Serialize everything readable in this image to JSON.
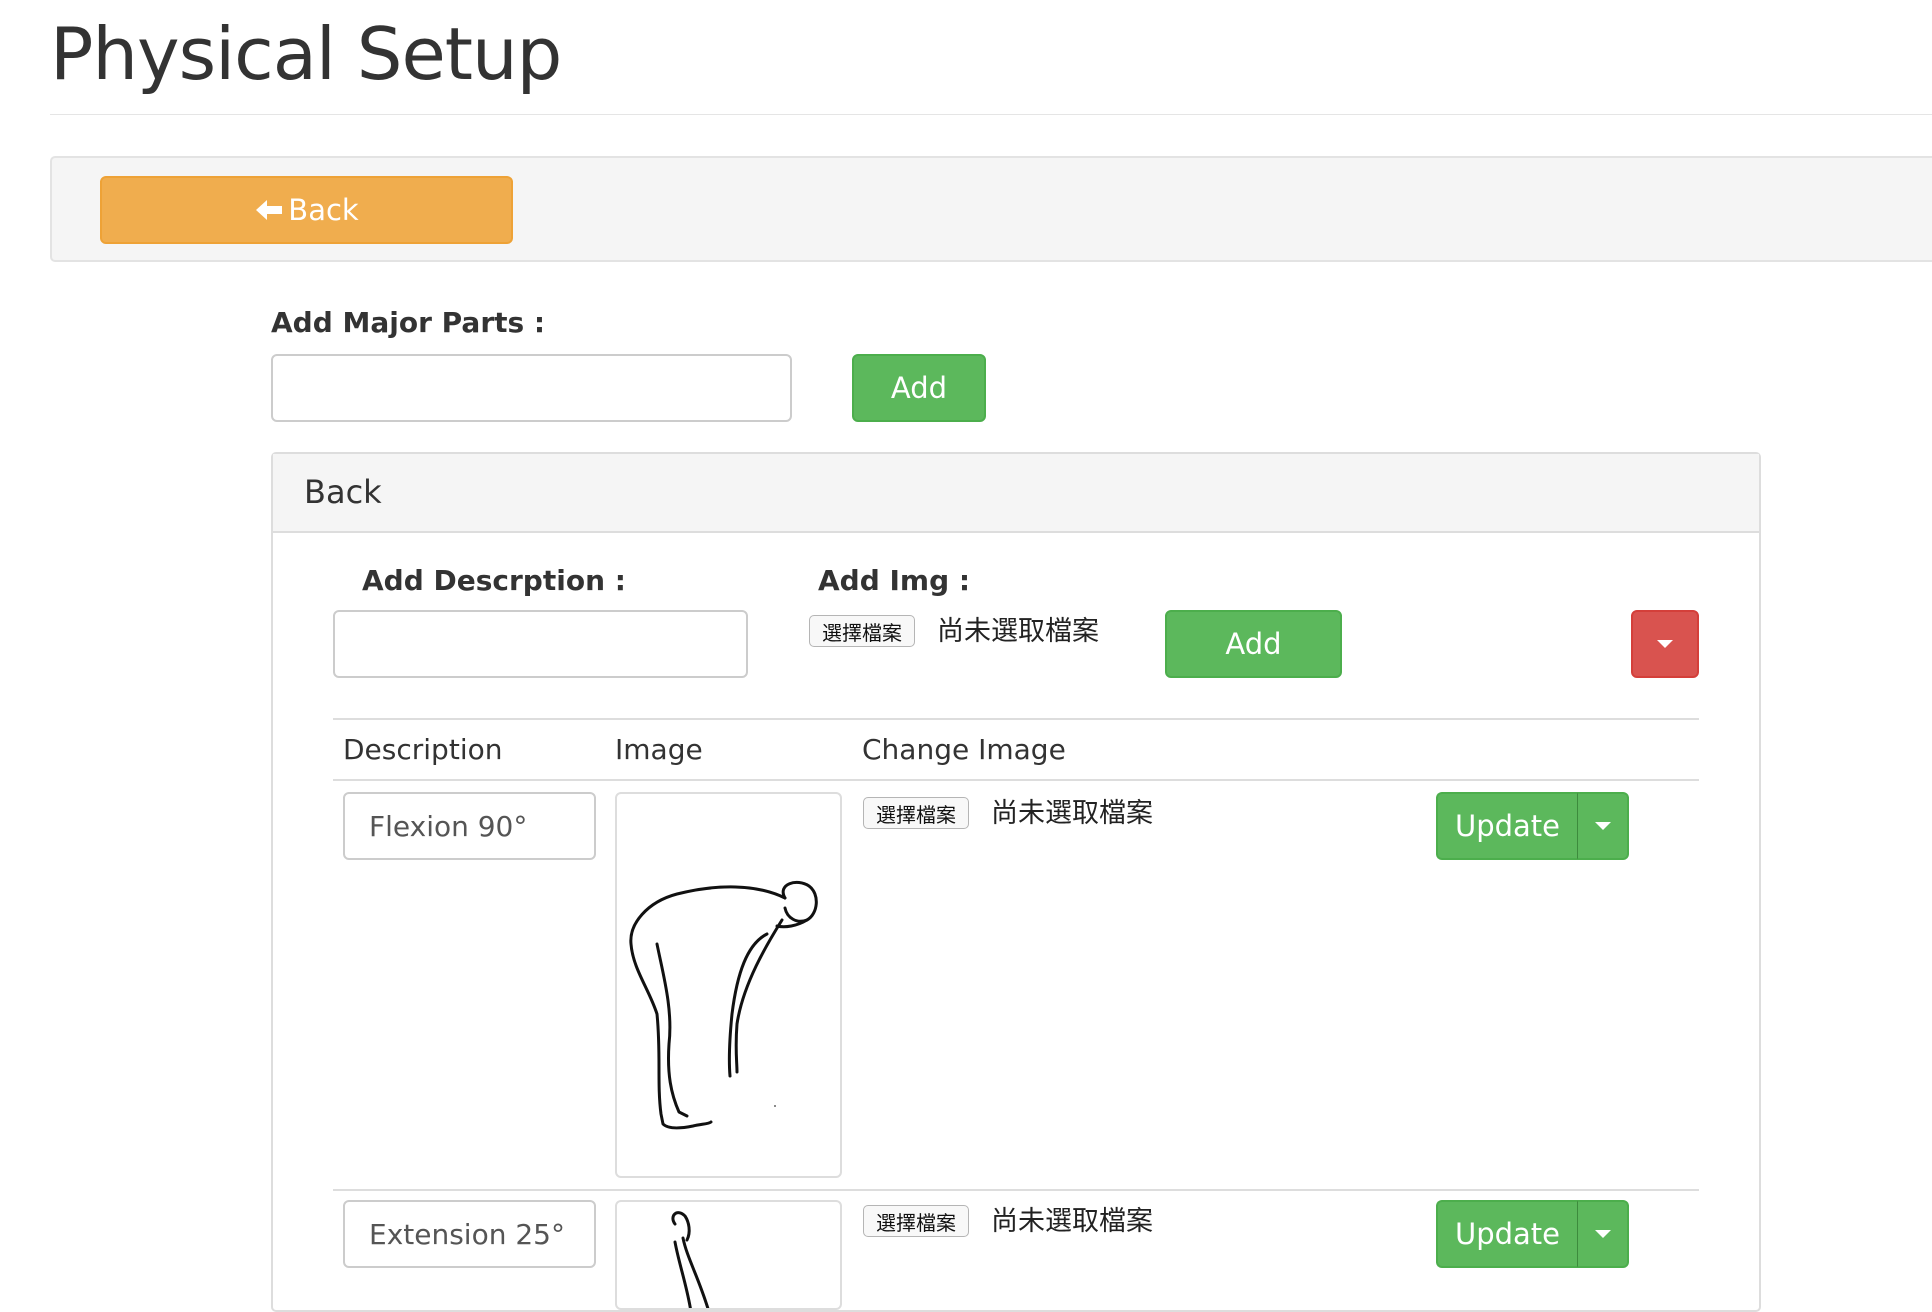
{
  "page": {
    "title": "Physical Setup"
  },
  "toolbar": {
    "back_label": "Back"
  },
  "major_parts": {
    "label": "Add Major Parts :",
    "input_value": "",
    "add_label": "Add"
  },
  "panel": {
    "title": "Back",
    "add_description_label": "Add Descrption :",
    "description_value": "",
    "add_img_label": "Add Img :",
    "file_button_label": "選擇檔案",
    "file_status": "尚未選取檔案",
    "add_label": "Add",
    "table": {
      "columns": [
        "Description",
        "Image",
        "Change Image"
      ],
      "rows": [
        {
          "description": "Flexion 90°",
          "file_button_label": "選擇檔案",
          "file_status": "尚未選取檔案",
          "update_label": "Update"
        },
        {
          "description": "Extension 25°",
          "file_button_label": "選擇檔案",
          "file_status": "尚未選取檔案",
          "update_label": "Update"
        }
      ]
    }
  },
  "colors": {
    "warning": "#f0ad4e",
    "success": "#5cb85c",
    "danger": "#d9534f"
  }
}
